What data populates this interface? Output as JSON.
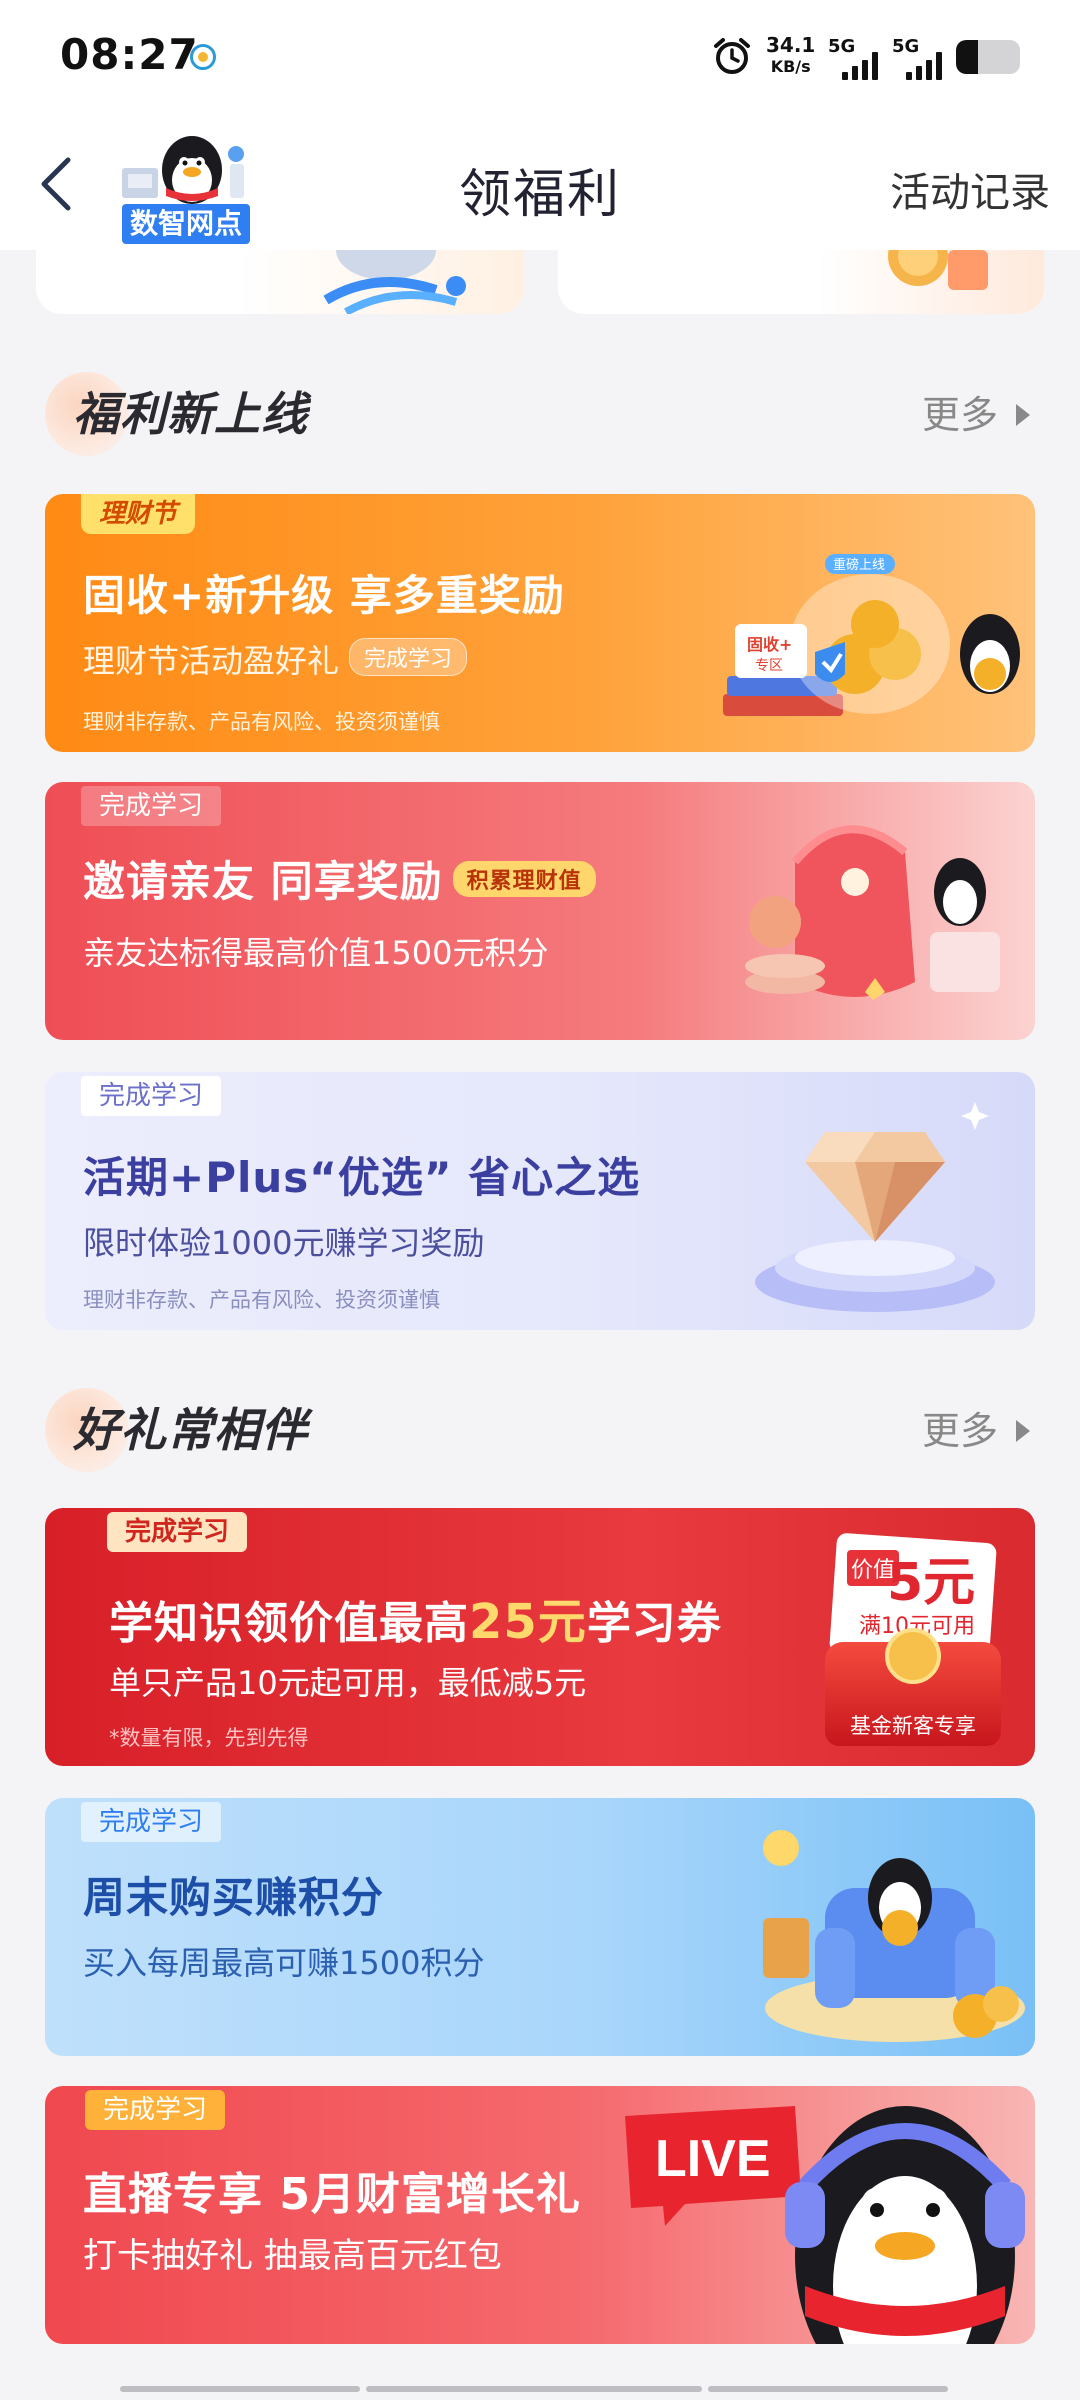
{
  "status_bar": {
    "time": "08:27",
    "speed_value": "34.1",
    "speed_unit": "KB/s",
    "sim1_label": "5G",
    "sim2_label": "5G"
  },
  "header": {
    "back_icon": "chevron-left-icon",
    "logo_text": "数智网点",
    "title": "领福利",
    "records_label": "活动记录"
  },
  "sections": [
    {
      "title": "福利新上线",
      "more_label": "更多",
      "banners": [
        {
          "tag": "理财节",
          "title": "固收+新升级 享多重奖励",
          "subtitle": "理财节活动盈好礼",
          "pill": "完成学习",
          "note": "理财非存款、产品有风险、投资须谨慎",
          "art_label_1": "重磅上线",
          "art_label_2": "固收+",
          "art_label_3": "专区"
        },
        {
          "tag": "完成学习",
          "title": "邀请亲友 同享奖励",
          "pill": "积累理财值",
          "subtitle": "亲友达标得最高价值1500元积分"
        },
        {
          "tag": "完成学习",
          "title": "活期+Plus“优选” 省心之选",
          "subtitle": "限时体验1000元赚学习奖励",
          "note": "理财非存款、产品有风险、投资须谨慎"
        }
      ]
    },
    {
      "title": "好礼常相伴",
      "more_label": "更多",
      "banners": [
        {
          "tag": "完成学习",
          "title_part1": "学知识领价值最高",
          "title_highlight": "25元",
          "title_part2": "学习券",
          "subtitle": "单只产品10元起可用，最低减5元",
          "note": "*数量有限，先到先得",
          "coupon_small": "价值",
          "coupon_value": "5元",
          "coupon_cond": "满10元可用",
          "coupon_caption": "基金新客专享"
        },
        {
          "tag": "完成学习",
          "title": "周末购买赚积分",
          "subtitle": "买入每周最高可赚1500积分"
        },
        {
          "tag": "完成学习",
          "title": "直播专享 5月财富增长礼",
          "subtitle": "打卡抽好礼 抽最高百元红包",
          "live_label": "LIVE"
        }
      ]
    }
  ],
  "colors": {
    "brand_blue": "#2f7ef2",
    "orange": "#ff8a1a",
    "red": "#e8323a",
    "purple_text": "#3a3fa0"
  }
}
